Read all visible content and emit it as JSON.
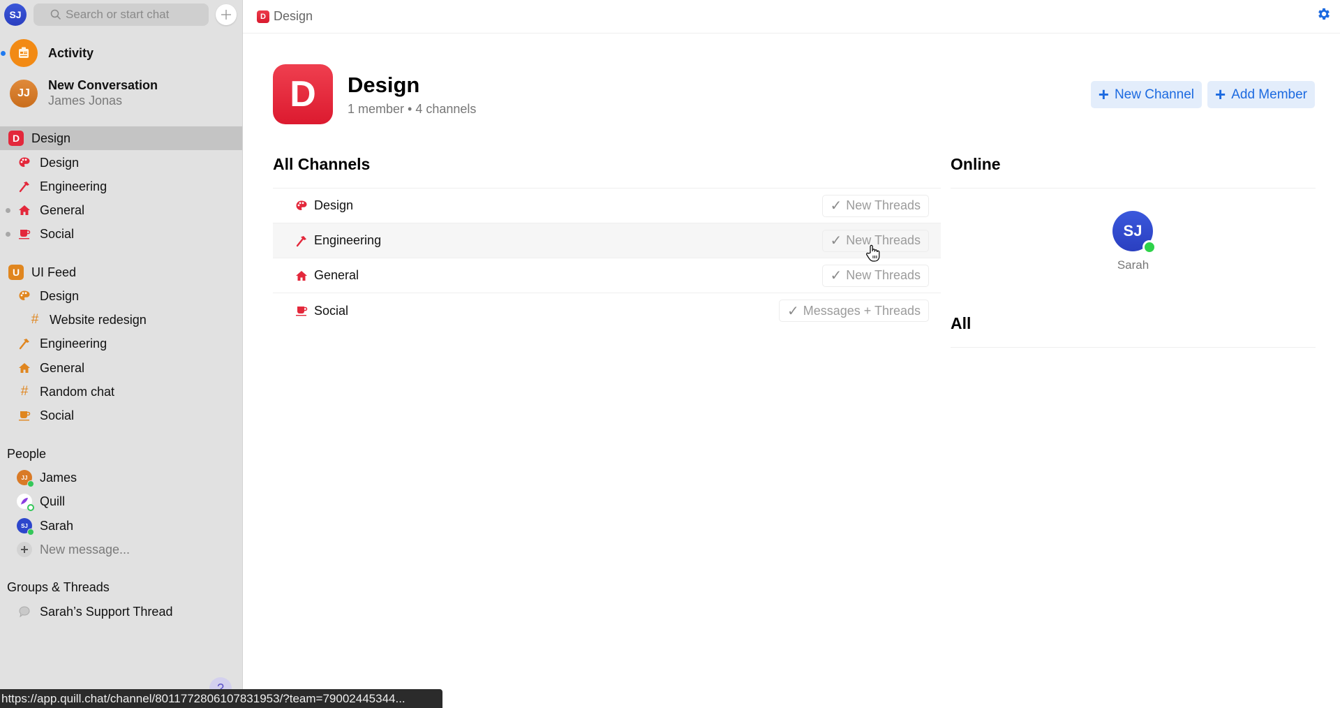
{
  "colors": {
    "accent": "#1c6ae0",
    "team_design": "#e3283b",
    "team_uifeed": "#e0861f",
    "online": "#34c759",
    "activity": "#f28a14"
  },
  "sidebar": {
    "me_initials": "SJ",
    "search_placeholder": "Search or start chat",
    "activity_label": "Activity",
    "conversation": {
      "title": "New Conversation",
      "subtitle": "James Jonas",
      "initials": "JJ"
    },
    "teams": [
      {
        "badge": "D",
        "name": "Design",
        "selected": true,
        "channels": [
          {
            "icon": "palette-icon",
            "label": "Design"
          },
          {
            "icon": "hammer-icon",
            "label": "Engineering"
          },
          {
            "icon": "house-icon",
            "label": "General",
            "unread": true
          },
          {
            "icon": "coffee-cup-icon",
            "label": "Social",
            "unread": true
          }
        ]
      },
      {
        "badge": "U",
        "name": "UI Feed",
        "channels": [
          {
            "icon": "palette-icon",
            "label": "Design"
          },
          {
            "icon": "hash-icon",
            "label": "Website redesign",
            "nested": true
          },
          {
            "icon": "hammer-icon",
            "label": "Engineering"
          },
          {
            "icon": "house-icon",
            "label": "General"
          },
          {
            "icon": "hash-icon",
            "label": "Random chat"
          },
          {
            "icon": "coffee-cup-icon",
            "label": "Social"
          }
        ]
      }
    ],
    "people_title": "People",
    "people": [
      {
        "initials": "JJ",
        "name": "James",
        "status": "online"
      },
      {
        "initials": "",
        "name": "Quill",
        "status": "bot"
      },
      {
        "initials": "SJ",
        "name": "Sarah",
        "status": "online"
      }
    ],
    "new_message_label": "New message...",
    "groups_title": "Groups & Threads",
    "threads": [
      {
        "label": "Sarah’s Support Thread"
      }
    ],
    "help_label": "?"
  },
  "topbar": {
    "badge": "D",
    "breadcrumb": "Design"
  },
  "team_header": {
    "badge": "D",
    "name": "Design",
    "meta": "1 member • 4 channels",
    "new_channel_label": "New Channel",
    "add_member_label": "Add Member"
  },
  "channels_section": {
    "title": "All Channels",
    "rows": [
      {
        "icon": "palette-icon",
        "name": "Design",
        "notify": "New Threads"
      },
      {
        "icon": "hammer-icon",
        "name": "Engineering",
        "notify": "New Threads",
        "hover": true
      },
      {
        "icon": "house-icon",
        "name": "General",
        "notify": "New Threads"
      },
      {
        "icon": "coffee-cup-icon",
        "name": "Social",
        "notify": "Messages + Threads"
      }
    ]
  },
  "members_section": {
    "online_title": "Online",
    "online": [
      {
        "initials": "SJ",
        "name": "Sarah"
      }
    ],
    "all_title": "All"
  },
  "statusbar": {
    "url": "https://app.quill.chat/channel/8011772806107831953/?team=79002445344..."
  }
}
